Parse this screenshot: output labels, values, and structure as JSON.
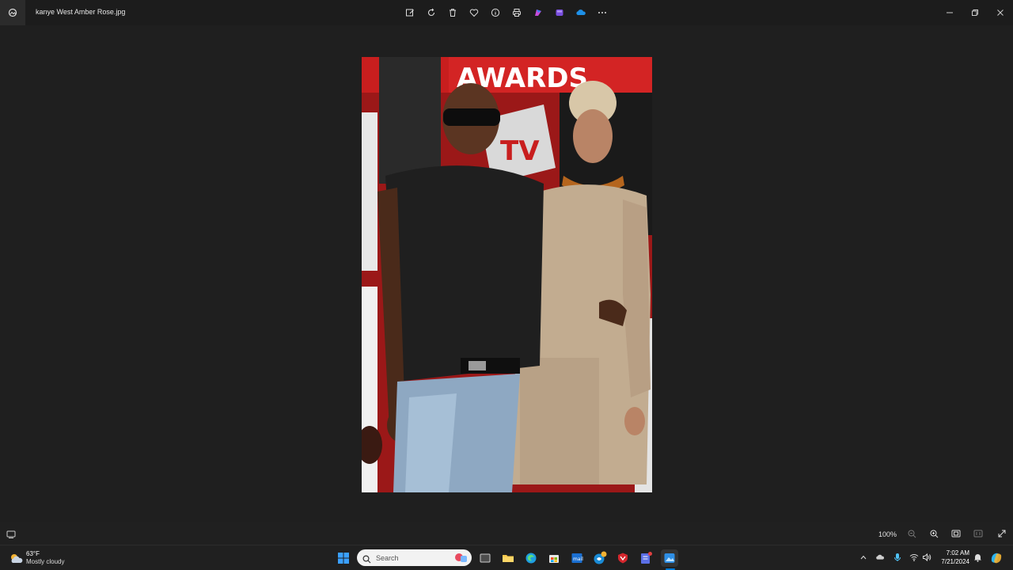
{
  "window": {
    "filename": "kanye West Amber Rose.jpg"
  },
  "toolbar": {
    "icons": [
      "edit-icon",
      "rotate-icon",
      "delete-icon",
      "favorite-icon",
      "info-icon",
      "print-icon",
      "designer-icon",
      "clipchamp-icon",
      "onedrive-icon",
      "more-icon"
    ]
  },
  "status": {
    "zoom": "100%"
  },
  "taskbar": {
    "weather_temp": "63°F",
    "weather_cond": "Mostly cloudy",
    "search_placeholder": "Search",
    "time": "7:02 AM",
    "date": "7/21/2024"
  },
  "colors": {
    "background": "#1c1c1c",
    "accent": "#0078d4"
  }
}
